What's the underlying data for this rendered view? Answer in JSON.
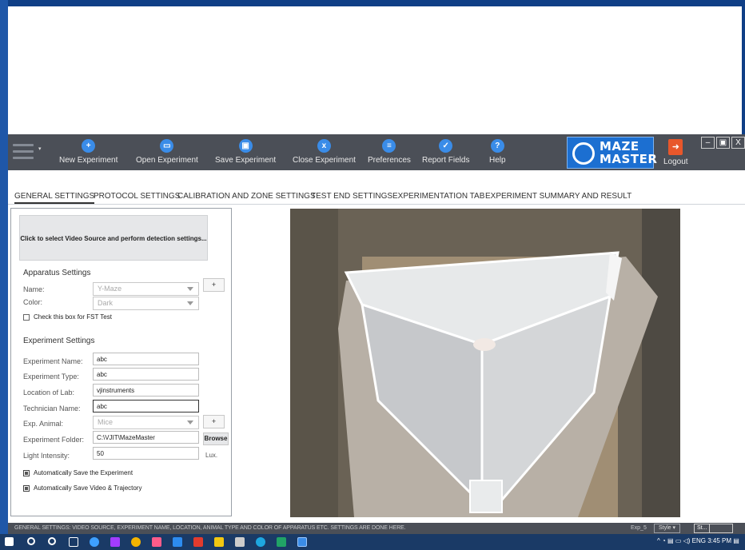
{
  "toolbar": {
    "buttons": [
      {
        "label": "New Experiment",
        "icon": "new-experiment-icon",
        "glyph": "+"
      },
      {
        "label": "Open Experiment",
        "icon": "folder-open-icon",
        "glyph": "▭"
      },
      {
        "label": "Save Experiment",
        "icon": "save-icon",
        "glyph": "▣"
      },
      {
        "label": "Close Experiment",
        "icon": "close-icon",
        "glyph": "x"
      },
      {
        "label": "Preferences",
        "icon": "toggle-settings-icon",
        "glyph": "≡"
      },
      {
        "label": "Report Fields",
        "icon": "check-square-icon",
        "glyph": "✓"
      },
      {
        "label": "Help",
        "icon": "help-icon",
        "glyph": "?"
      }
    ],
    "logo_line1": "MAZE",
    "logo_line2": "MASTER",
    "logout_label": "Logout",
    "window_controls": {
      "minimize": "–",
      "restore": "▣",
      "close": "X"
    }
  },
  "tabs": [
    "GENERAL SETTINGS",
    "PROTOCOL SETTINGS",
    "CALIBRATION AND ZONE SETTINGS",
    "TEST END SETTINGS",
    "EXPERIMENTATION TAB",
    "EXPERIMENT SUMMARY AND RESULT"
  ],
  "video_source_button": "Click to select Video Source and perform detection settings...",
  "apparatus": {
    "heading": "Apparatus Settings",
    "name_label": "Name:",
    "name_value": "Y-Maze",
    "color_label": "Color:",
    "color_value": "Dark",
    "add_button": "+",
    "fst_checkbox": "Check this box for FST Test",
    "fst_checked": false
  },
  "experiment": {
    "heading": "Experiment Settings",
    "name_label": "Experiment Name:",
    "name_value": "abc",
    "type_label": "Experiment Type:",
    "type_value": "abc",
    "location_label": "Location of Lab:",
    "location_value": "vjinstruments",
    "technician_label": "Technician Name:",
    "technician_value": "abc",
    "animal_label": "Exp. Animal:",
    "animal_value": "Mice",
    "animal_add": "+",
    "folder_label": "Experiment Folder:",
    "folder_value": "C:\\VJIT\\MazeMaster",
    "browse_label": "Browse",
    "light_label": "Light Intensity:",
    "light_value": "50",
    "light_unit": "Lux.",
    "autosave_experiment": "Automatically Save the Experiment",
    "autosave_experiment_checked": true,
    "autosave_video": "Automatically Save Video & Trajectory",
    "autosave_video_checked": true
  },
  "status": {
    "message": "GENERAL SETTINGS: VIDEO SOURCE, EXPERIMENT NAME, LOCATION, ANIMAL TYPE AND COLOR OF APPARATUS ETC. SETTINGS ARE DONE HERE.",
    "experiment_id": "Exp_5",
    "style_label": "Style",
    "st_label": "St..."
  },
  "taskbar": {
    "time": "3:45 PM",
    "language": "ENG"
  },
  "colors": {
    "toolbar_bg": "#4b4f57",
    "accent_blue": "#3a8ce8",
    "logo_blue": "#1c6fd1",
    "logout_orange": "#e8572b"
  }
}
